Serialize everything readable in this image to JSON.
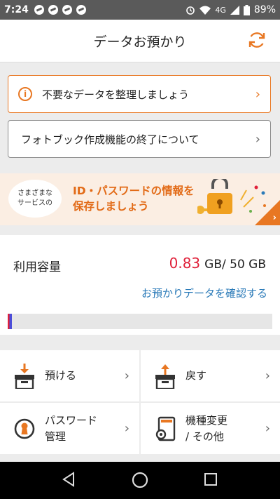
{
  "status_bar": {
    "time": "7:24",
    "network": "4G",
    "battery": "89%",
    "icons": [
      "app-icon",
      "app-icon",
      "app-icon",
      "app-icon",
      "alarm-icon",
      "wifi-icon",
      "signal-icon",
      "battery-icon"
    ]
  },
  "header": {
    "title": "データお預かり",
    "refresh_icon": "refresh-icon"
  },
  "notices": [
    {
      "label": "不要なデータを整理しましょう",
      "icon": "info-icon"
    },
    {
      "label": "フォトブック作成機能の終了について"
    }
  ],
  "banner": {
    "bubble_line1": "さまざまな",
    "bubble_line2": "サービスの",
    "line1": "ID・パスワードの情報を",
    "line2": "保存しましょう"
  },
  "usage": {
    "label": "利用容量",
    "used": "0.83",
    "unit_total": "GB/ 50 GB",
    "link": "お預かりデータを確認する",
    "progress_fraction": 0.0166
  },
  "menu": {
    "deposit": {
      "label": "預ける",
      "icon": "deposit-box-icon"
    },
    "restore": {
      "label": "戻す",
      "icon": "restore-box-icon"
    },
    "password": {
      "line1": "パスワード",
      "line2": "管理",
      "icon": "keyhole-icon"
    },
    "device": {
      "line1": "機種変更",
      "line2": "/ その他",
      "icon": "phone-gear-icon"
    }
  },
  "colors": {
    "accent": "#e87722",
    "used_value": "#e0213a",
    "link": "#2a7ab8"
  }
}
